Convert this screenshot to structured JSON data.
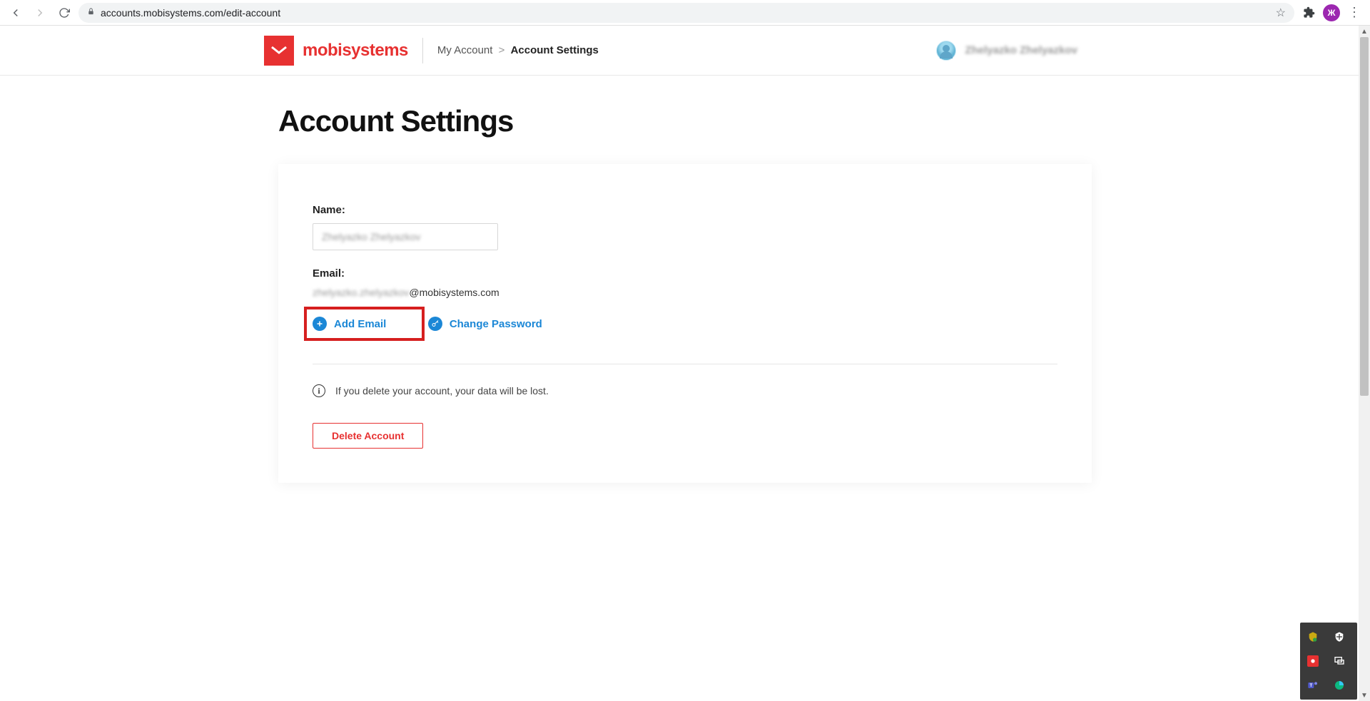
{
  "browser": {
    "url": "accounts.mobisystems.com/edit-account",
    "profile_initial": "Ж"
  },
  "header": {
    "brand": "mobisystems",
    "breadcrumb": {
      "root": "My Account",
      "current": "Account Settings"
    },
    "user_display": "Zhelyazko Zhelyazkov"
  },
  "page": {
    "title": "Account Settings"
  },
  "form": {
    "name_label": "Name:",
    "name_value": "Zhelyazko Zhelyazkov",
    "email_label": "Email:",
    "email_local": "zhelyazko.zhelyazkov",
    "email_domain": "@mobisystems.com",
    "add_email_label": "Add Email",
    "change_password_label": "Change Password",
    "delete_warning": "If you delete your account, your data will be lost.",
    "delete_button": "Delete Account"
  },
  "colors": {
    "brand_red": "#e73131",
    "link_blue": "#1b87d6",
    "highlight_red": "#d61f1f"
  }
}
